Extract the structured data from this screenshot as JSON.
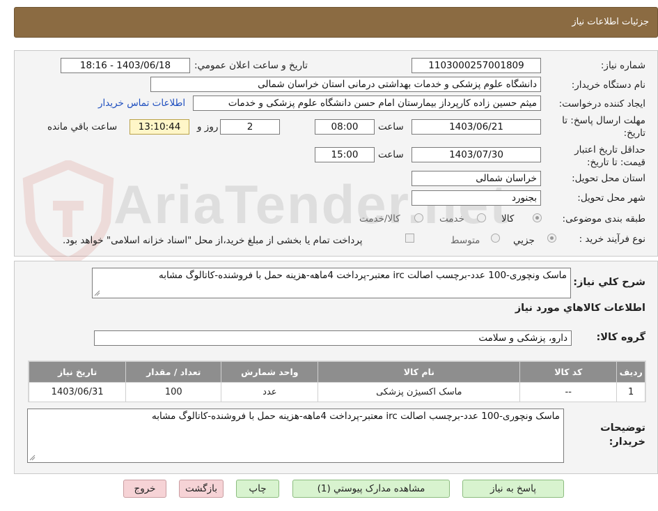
{
  "header": {
    "title": "جزئیات اطلاعات نیاز"
  },
  "form": {
    "need_number": {
      "label": "شماره نیاز:",
      "value": "1103000257001809"
    },
    "announce": {
      "label": "تاریخ و ساعت اعلان عمومي:",
      "value": "1403/06/18 - 18:16"
    },
    "buyer_org": {
      "label": "نام دستگاه خریدار:",
      "value": "دانشگاه علوم پزشکی و خدمات بهداشتی درمانی استان خراسان شمالی"
    },
    "requester": {
      "label": "ایجاد کننده درخواست:",
      "value": "میثم  حسین زاده  کارپرداز بیمارستان امام حسن دانشگاه علوم پزشکی و خدمات",
      "contact_link": "اطلاعات تماس خریدار"
    },
    "send_deadline": {
      "label": "مهلت ارسال پاسخ: تا تاریخ:",
      "date": "1403/06/21",
      "time_label": "ساعت",
      "time": "08:00",
      "days": "2",
      "days_label": "روز و",
      "remaining": "13:10:44",
      "remaining_label": "ساعت باقي مانده"
    },
    "validity": {
      "label": "حداقل تاریخ اعتبار قیمت: تا تاریخ:",
      "date": "1403/07/30",
      "time_label": "ساعت",
      "time": "15:00"
    },
    "province": {
      "label": "استان محل تحویل:",
      "value": "خراسان شمالی"
    },
    "city": {
      "label": "شهر محل تحویل:",
      "value": "بجنورد"
    },
    "category": {
      "label": "طبقه بندی موضوعی:",
      "options": [
        "کالا",
        "خدمت",
        "کالا/خدمت"
      ],
      "selected": "کالا"
    },
    "purchase_type": {
      "label": "نوع فرآیند خرید :",
      "options": [
        "جزیي",
        "متوسط"
      ],
      "selected": "جزیي",
      "note": "پرداخت تمام یا بخشی از مبلغ خرید،از محل \"اسناد خزانه اسلامی\" خواهد بود."
    }
  },
  "need": {
    "summary_label": "شرح کلي نياز:",
    "summary": "ماسک ونچوری-100 عدد-برچسب اصالت irc معتبر-پرداخت 4ماهه-هزینه حمل با فروشنده-کاتالوگ مشابه",
    "goods_heading": "اطلاعات کالاهاي مورد نياز",
    "group_label": "گروه کالا:",
    "group": "دارو، پزشکی و سلامت",
    "table": {
      "headers": [
        "ردیف",
        "کد کالا",
        "نام کالا",
        "واحد شمارش",
        "تعداد / مقدار",
        "تاریخ نیاز"
      ],
      "rows": [
        [
          "1",
          "--",
          "ماسک اکسیژن پزشکی",
          "عدد",
          "100",
          "1403/06/31"
        ]
      ]
    },
    "buyer_notes_label": "توضیحات خریدار:",
    "buyer_notes": "ماسک ونچوری-100 عدد-برچسب اصالت irc معتبر-پرداخت 4ماهه-هزینه حمل با فروشنده-کاتالوگ مشابه"
  },
  "buttons": {
    "reply": "پاسخ به نیاز",
    "attachments": "مشاهده مدارک پیوستي (1)",
    "print": "چاپ",
    "back": "بازگشت",
    "exit": "خروج"
  },
  "watermark": {
    "text": "AriaTender.net"
  }
}
